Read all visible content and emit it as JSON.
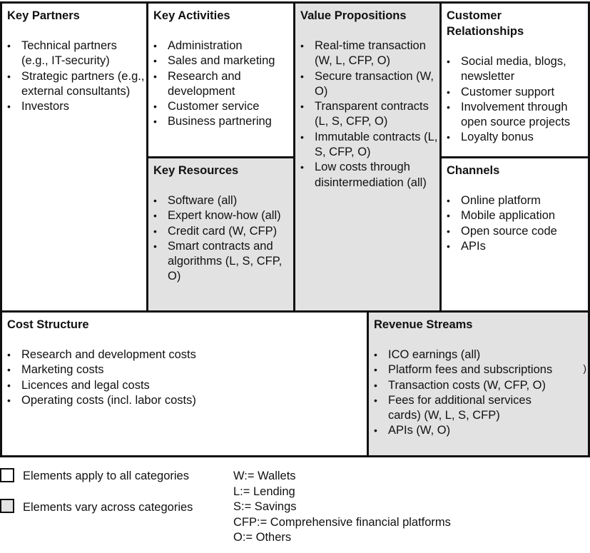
{
  "canvas": {
    "key_partners": {
      "title": "Key Partners",
      "items": [
        "Technical partners (e.g., IT-security)",
        "Strategic partners (e.g., external consultants)",
        "Investors"
      ],
      "varies": false
    },
    "key_activities": {
      "title": "Key Activities",
      "items": [
        "Administration",
        "Sales and marketing",
        "Research and development",
        "Customer service",
        "Business partnering"
      ],
      "varies": false
    },
    "key_resources": {
      "title": "Key Resources",
      "items": [
        "Software (all)",
        "Expert know-how (all)",
        "Credit card (W, CFP)",
        "Smart contracts and algorithms (L, S, CFP, O)"
      ],
      "varies": true
    },
    "value_propositions": {
      "title": "Value Propositions",
      "items": [
        "Real-time transaction (W, L, CFP, O)",
        "Secure transaction (W, O)",
        "Transparent contracts (L, S, CFP, O)",
        "Immutable contracts (L, S, CFP, O)",
        "Low costs through disintermediation (all)"
      ],
      "varies": true
    },
    "customer_relationships": {
      "title": "Customer Relationships",
      "items": [
        "Social media, blogs, newsletter",
        "Customer support",
        "Involvement through open source projects",
        "Loyalty bonus"
      ],
      "varies": false
    },
    "channels": {
      "title": "Channels",
      "items": [
        "Online platform",
        "Mobile application",
        "Open source code",
        "APIs"
      ],
      "varies": false
    },
    "cost_structure": {
      "title": "Cost Structure",
      "items": [
        "Research and development costs",
        "Marketing costs",
        "Licences and legal costs",
        "Operating costs (incl. labor costs)"
      ],
      "varies": false
    },
    "revenue_streams": {
      "title": "Revenue Streams",
      "items": [
        "ICO earnings (all)",
        "Platform fees and subscriptions",
        "Transaction costs (W, CFP, O)",
        "Fees for additional services cards) (W, L, S, CFP)",
        "APIs (W, O)"
      ],
      "stray_glyph": ")",
      "varies": true
    }
  },
  "legend": {
    "all_categories": "Elements apply to all categories",
    "vary_categories": "Elements vary across categories",
    "abbreviations": [
      "W:= Wallets",
      "L:= Lending",
      "S:= Savings",
      "CFP:= Comprehensive financial platforms",
      "O:= Others"
    ]
  },
  "colors": {
    "shaded": "#e2e2e2",
    "border": "#111111",
    "white": "#ffffff"
  }
}
